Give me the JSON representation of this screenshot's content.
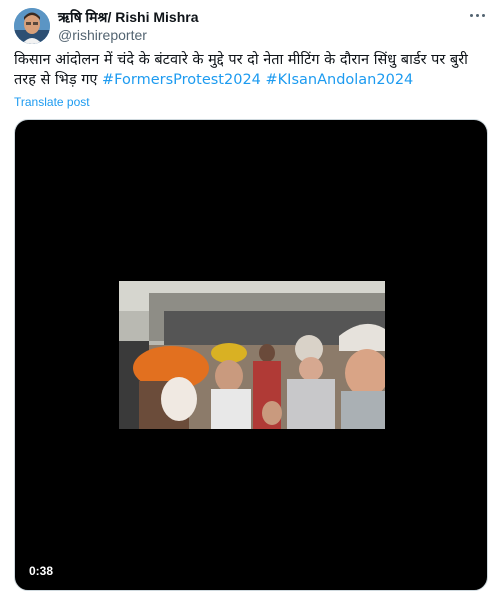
{
  "author": {
    "display_name": "ऋषि मिश्र/ Rishi Mishra",
    "handle": "@rishireporter",
    "avatar_icon": "avatar-icon"
  },
  "post": {
    "text": "किसान आंदोलन में चंदे के बंटवारे के मुद्दे पर  दो नेता मीटिंग के दौरान सिंधु बार्डर पर बुरी तरह से भिड़ गए",
    "hashtags": [
      "#FormersProtest2024",
      "#KIsanAndolan2024"
    ],
    "translate_label": "Translate post"
  },
  "media": {
    "type": "video",
    "duration": "0:38"
  },
  "colors": {
    "link": "#1d9bf0",
    "text": "#0f1419",
    "muted": "#536471"
  }
}
